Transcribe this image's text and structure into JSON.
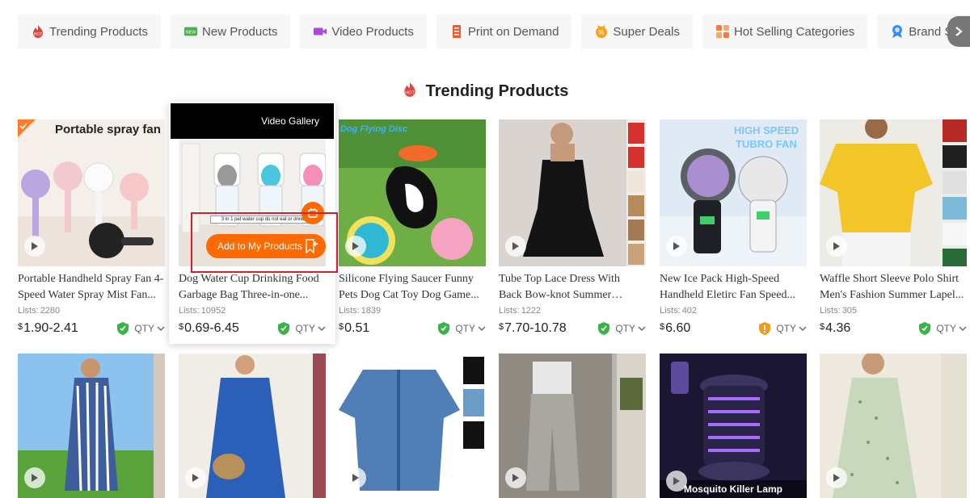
{
  "tabs": [
    {
      "label": "Trending Products",
      "icon": "flame-badge-icon",
      "color": "#e8413b"
    },
    {
      "label": "New Products",
      "icon": "new-badge-icon",
      "color": "#4caf50"
    },
    {
      "label": "Video Products",
      "icon": "video-icon",
      "color": "#a64bd6"
    },
    {
      "label": "Print on Demand",
      "icon": "print-icon",
      "color": "#ef5b2b"
    },
    {
      "label": "Super Deals",
      "icon": "deal-icon",
      "color": "#f7a21b"
    },
    {
      "label": "Hot Selling Categories",
      "icon": "categories-icon",
      "color": "#f47b3c"
    },
    {
      "label": "Brand Section",
      "icon": "brand-icon",
      "color": "#3a8ee6"
    }
  ],
  "section": {
    "title": "Trending Products"
  },
  "hover": {
    "video_gallery": "Video Gallery",
    "add_label": "Add to My Products",
    "image_label": "3 in 1 pet water cup do not eat or drink"
  },
  "image_captions": {
    "fan": "Portable spray fan",
    "dog": "Dog Flying Disc",
    "turbo1": "HIGH SPEED",
    "turbo2": "TUBRO FAN",
    "mosquito": "Mosquito Killer Lamp"
  },
  "qty_label": "QTY",
  "lists_label": "Lists:",
  "currency": "$",
  "products_row1": [
    {
      "name": "Portable Handheld Spray Fan 4-Speed Water Spray Mist Fan...",
      "lists": "2280",
      "price": "1.90-2.41",
      "shield": "green"
    },
    {
      "name": "Dog Water Cup Drinking Food Garbage Bag Three-in-one...",
      "lists": "10952",
      "price": "0.69-6.45",
      "shield": "green"
    },
    {
      "name": "Silicone Flying Saucer Funny Pets Dog Cat Toy Dog Game...",
      "lists": "1839",
      "price": "0.51",
      "shield": "green"
    },
    {
      "name": "Tube Top Lace Dress With Back Bow-knot Summer Fashion...",
      "lists": "1222",
      "price": "7.70-10.78",
      "shield": "green"
    },
    {
      "name": "New Ice Pack High-Speed Handheld Eletirc Fan Speed...",
      "lists": "402",
      "price": "6.60",
      "shield": "orange"
    },
    {
      "name": "Waffle Short Sleeve Polo Shirt Men's Fashion Summer Lapel...",
      "lists": "305",
      "price": "4.36",
      "shield": "green"
    }
  ],
  "colors": {
    "accent": "#ff6a00",
    "highlight": "#d9202a",
    "shield_green": "#3bb34a",
    "shield_orange": "#f29b1d"
  }
}
